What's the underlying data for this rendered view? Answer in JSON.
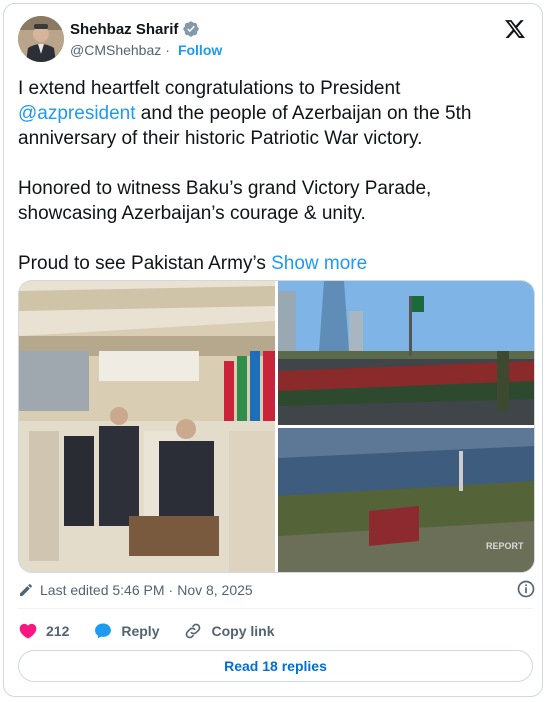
{
  "author": {
    "name": "Shehbaz Sharif",
    "handle": "@CMShehbaz",
    "separator": "·",
    "follow_label": "Follow"
  },
  "tweet": {
    "line1_prefix": "I extend heartfelt congratulations to President ",
    "mention": "@azpresident",
    "line1_suffix": " and the people of Azerbaijan on the 5th anniversary of their historic Patriotic War victory.",
    "paragraph2": "Honored to witness Baku’s grand Victory Parade, showcasing Azerbaijan’s courage & unity.",
    "paragraph3_prefix": "Proud to see Pakistan Army’s ",
    "show_more": "Show more"
  },
  "media": {
    "watermark": "REPORT"
  },
  "meta": {
    "edited_label": "Last edited 5:46 PM",
    "separator": "·",
    "date": "Nov 8, 2025"
  },
  "actions": {
    "like_count": "212",
    "reply_label": "Reply",
    "copy_link_label": "Copy link"
  },
  "replies_button": "Read 18 replies",
  "colors": {
    "accent": "#1d9bf0",
    "like": "#f91880",
    "muted": "#536471",
    "text": "#0f1419"
  }
}
